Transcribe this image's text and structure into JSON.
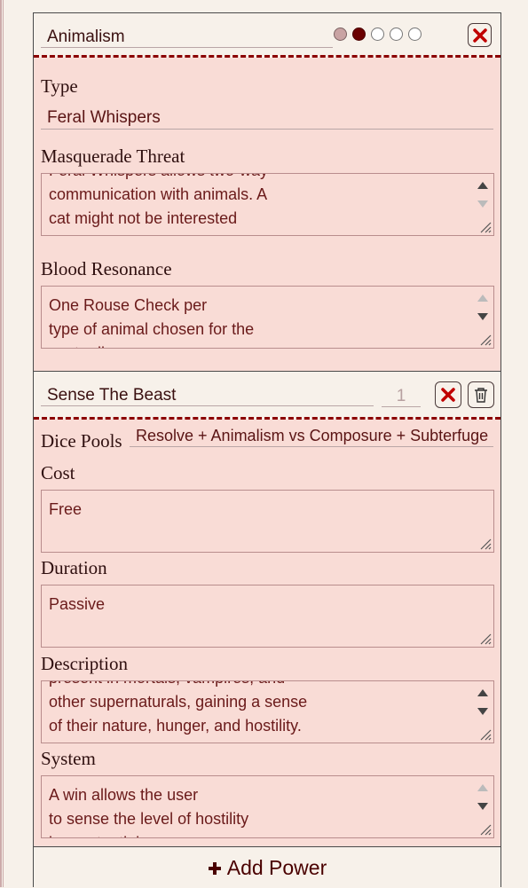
{
  "discipline": {
    "name": "Animalism",
    "dots_filled": 2,
    "dots_total": 5,
    "type_label": "Type",
    "type_value": "Feral Whispers",
    "threat_label": "Masquerade Threat",
    "threat_text": "Feral Whispers allows two-way\ncommunication with animals. A\ncat might not be interested",
    "resonance_label": "Blood Resonance",
    "resonance_text": "One Rouse Check per\ntype of animal chosen for the\nnext roll...",
    "close_icon": "close-x-icon"
  },
  "power": {
    "name": "Sense The Beast",
    "level": "1",
    "dice_pools_label": "Dice Pools",
    "dice_pools_value": "Resolve + Animalism vs Composure + Subterfuge",
    "cost_label": "Cost",
    "cost_value": "Free",
    "duration_label": "Duration",
    "duration_value": "Passive",
    "description_label": "Description",
    "description_text": "present in mortals, vampires, and\nother supernaturals, gaining a sense\nof their nature, hunger, and hostility.",
    "system_label": "System",
    "system_text": "A win allows the user\nto sense the level of hostility\nin a potential enemy...",
    "icons": [
      "close-x-icon",
      "trash-icon"
    ]
  },
  "add_power_label": "Add Power",
  "colors": {
    "accent": "#8b0000",
    "panel_bg": "#f9dcd6",
    "page_bg": "#f7f1ea"
  }
}
